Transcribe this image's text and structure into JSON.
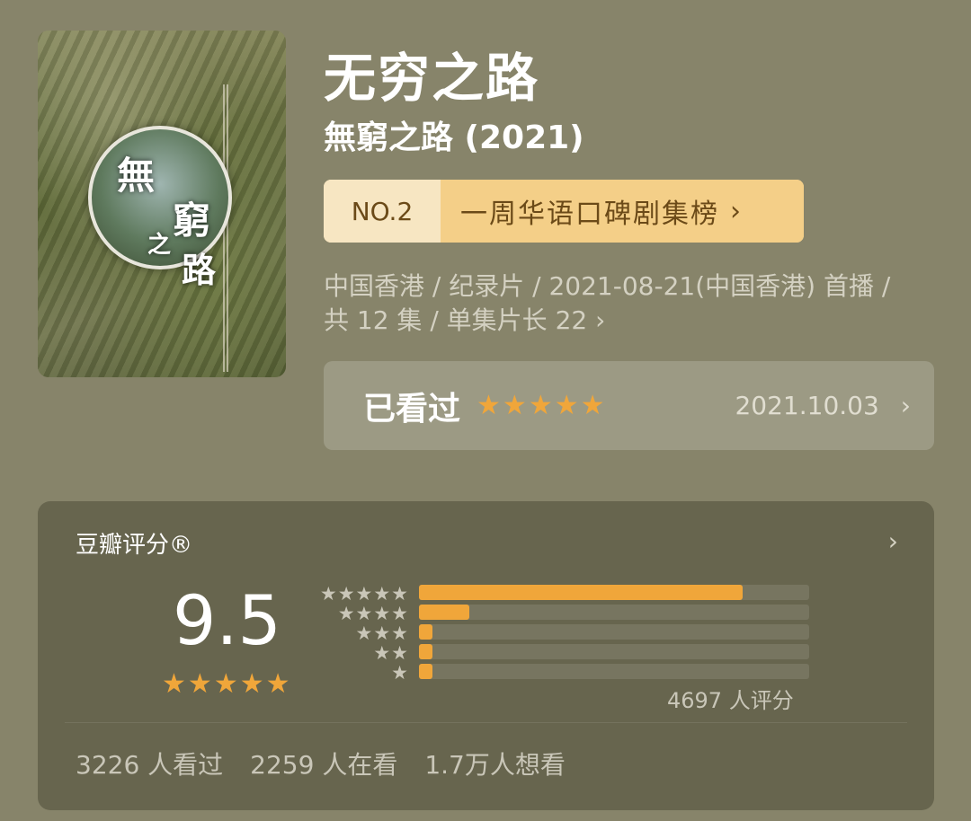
{
  "show": {
    "title": "无穷之路",
    "subtitle": "無窮之路 (2021)",
    "poster_text": [
      "無",
      "窮",
      "之",
      "路"
    ]
  },
  "rank": {
    "number": "NO.2",
    "label": "一周华语口碑剧集榜",
    "chevron": "›"
  },
  "meta": {
    "line1": "中国香港 / 纪录片 / 2021-08-21(中国香港) 首播 /",
    "line2": "共 12 集 / 单集片长 22 ›"
  },
  "watched": {
    "label": "已看过",
    "stars": 5,
    "date": "2021.10.03",
    "chevron": "›"
  },
  "rating": {
    "title": "豆瓣评分®",
    "chevron": "›",
    "score": "9.5",
    "stars": 5,
    "distribution": [
      {
        "stars": 5,
        "fraction": 0.83
      },
      {
        "stars": 4,
        "fraction": 0.13
      },
      {
        "stars": 3,
        "fraction": 0.03
      },
      {
        "stars": 2,
        "fraction": 0.03
      },
      {
        "stars": 1,
        "fraction": 0.03
      }
    ],
    "count_text": "4697 人评分",
    "stats": [
      "3226 人看过",
      "2259 人在看",
      "1.7万人想看"
    ]
  },
  "colors": {
    "background": "#87846a",
    "accent": "#f0a63a",
    "badge": "#f4cf88"
  }
}
